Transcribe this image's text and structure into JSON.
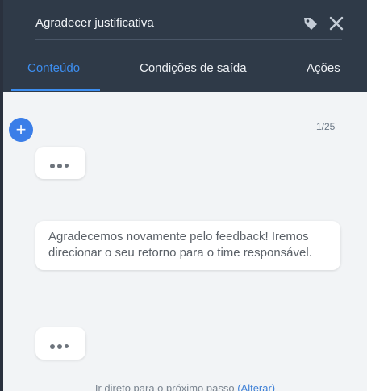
{
  "header": {
    "title": "Agradecer justificativa",
    "icons": {
      "tag": "tag-icon",
      "close": "close-icon"
    }
  },
  "tabs": [
    {
      "label": "Conteúdo",
      "active": true
    },
    {
      "label": "Condições de saída",
      "active": false
    },
    {
      "label": "Ações",
      "active": false
    }
  ],
  "content": {
    "counter": "1/25",
    "message_text": "Agradecemos novamente pelo feedback! Iremos direcionar o seu retorno para o time responsável.",
    "footer_text": "Ir direto para o próximo passo",
    "footer_link": "(Alterar)"
  },
  "colors": {
    "accent": "#3d8ef0",
    "header_bg": "#2f3a48",
    "content_bg": "#f2f4f6"
  }
}
